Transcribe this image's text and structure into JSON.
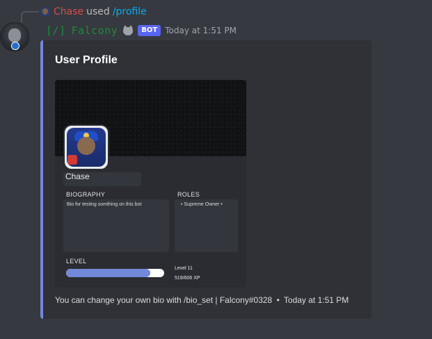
{
  "reply": {
    "user": "Chase",
    "action": "used",
    "command": "/profile"
  },
  "message": {
    "author": "[/] Falcony",
    "author_bracket": "[/]",
    "author_name": "Falcony",
    "bot_tag": "BOT",
    "timestamp": "Today at 1:51 PM",
    "icons": [
      "reply-avatar",
      "user-avatar",
      "wolf-emoji"
    ]
  },
  "embed": {
    "accent_color": "#7289da",
    "title": "User Profile",
    "profile": {
      "name": "Chase",
      "biography_label": "BIOGRAPHY",
      "biography": "Bio for testing somthing on this bot",
      "roles_label": "ROLES",
      "roles": "• Supreme Owner •",
      "level_label": "LEVEL",
      "level_text": "Level 11",
      "xp_text": "519/606 XP",
      "xp_progress": 0.856
    },
    "footer": {
      "text": "You can change your own bio with /bio_set | Falcony#0328",
      "separator": "•",
      "timestamp": "Today at 1:51 PM"
    }
  }
}
